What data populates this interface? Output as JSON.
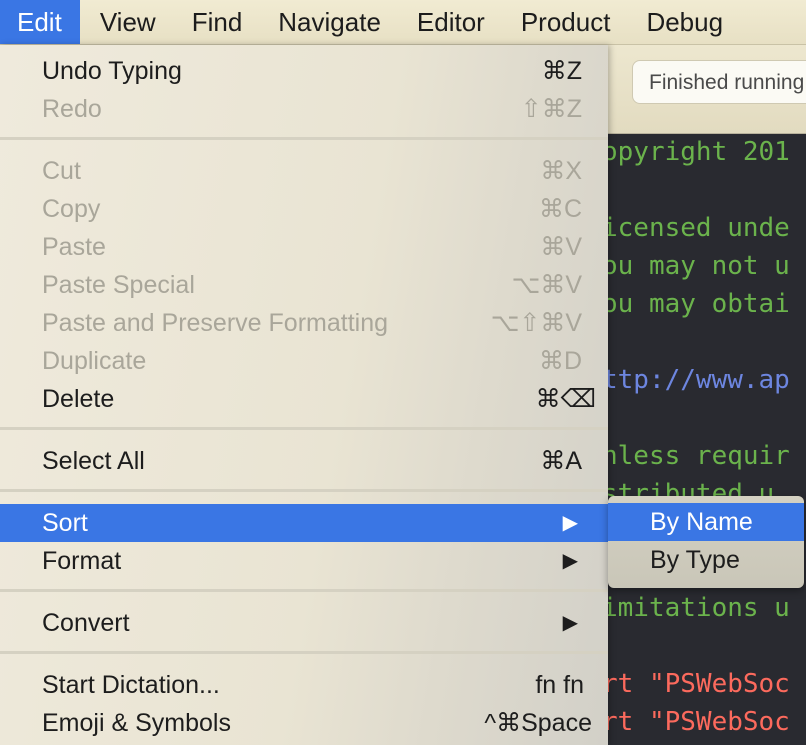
{
  "menubar": {
    "items": [
      "Edit",
      "View",
      "Find",
      "Navigate",
      "Editor",
      "Product",
      "Debug"
    ]
  },
  "toolbar": {
    "status": "Finished running"
  },
  "code": {
    "lines": [
      "opyright 201",
      "icensed unde",
      "ou may not u",
      "ou may obtai",
      "ttp://www.ap",
      "nless requir",
      "stributed u",
      "imitations u",
      "rt \"PSWebSoc",
      "rt \"PSWebSoc"
    ]
  },
  "edit_menu": {
    "undo": {
      "label": "Undo Typing",
      "shortcut": "⌘Z"
    },
    "redo": {
      "label": "Redo",
      "shortcut": "⇧⌘Z"
    },
    "cut": {
      "label": "Cut",
      "shortcut": "⌘X"
    },
    "copy": {
      "label": "Copy",
      "shortcut": "⌘C"
    },
    "paste": {
      "label": "Paste",
      "shortcut": "⌘V"
    },
    "paste_special": {
      "label": "Paste Special",
      "shortcut": "⌥⌘V"
    },
    "paste_preserve": {
      "label": "Paste and Preserve Formatting",
      "shortcut": "⌥⇧⌘V"
    },
    "duplicate": {
      "label": "Duplicate",
      "shortcut": "⌘D"
    },
    "delete": {
      "label": "Delete",
      "shortcut": "⌘⌫"
    },
    "select_all": {
      "label": "Select All",
      "shortcut": "⌘A"
    },
    "sort": {
      "label": "Sort",
      "arrow": "▶"
    },
    "format": {
      "label": "Format",
      "arrow": "▶"
    },
    "convert": {
      "label": "Convert",
      "arrow": "▶"
    },
    "dictation": {
      "label": "Start Dictation...",
      "shortcut": "fn fn"
    },
    "emoji": {
      "label": "Emoji & Symbols",
      "shortcut": "^⌘Space"
    }
  },
  "sort_submenu": {
    "by_name": "By Name",
    "by_type": "By Type"
  },
  "colors": {
    "highlight": "#3a76e4",
    "disabled_text": "#a9a69a",
    "code_bg": "#292a30",
    "comment_green": "#6bb34c",
    "url_blue": "#6d86e0",
    "string_red": "#fc6a5d"
  },
  "icons": {
    "submenu_arrow": "submenu-arrow-icon"
  }
}
